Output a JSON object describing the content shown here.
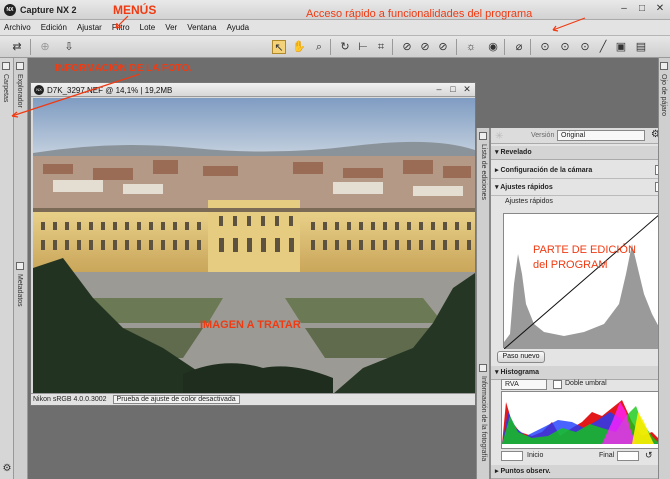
{
  "window": {
    "title": "Capture NX 2",
    "logo_text": "NX"
  },
  "menu": {
    "items": [
      "Archivo",
      "Edición",
      "Ajustar",
      "Filtro",
      "Lote",
      "Ver",
      "Ventana",
      "Ayuda"
    ]
  },
  "left_panels": {
    "carpetas": "Carpetas",
    "explorador": "Explorador",
    "metadatos": "Metadatos"
  },
  "image_window": {
    "title": "D7K_3297.NEF @ 14,1% | 19,2MB",
    "profile": "Nikon sRGB 4.0.0.3002",
    "proof_select": "Prueba de ajuste de color desactivada"
  },
  "right_strips": {
    "edit_list": "Lista de ediciones",
    "photo_info": "Información de la fotografía",
    "eye_label": "Ojo de pájaro"
  },
  "edit_panel": {
    "version_label": "Versión",
    "version_value": "Original",
    "revelado": "Revelado",
    "camera_config": "Configuración de la cámara",
    "quick_adjust_header": "Ajustes rápidos",
    "quick_adjust_item": "Ajustes rápidos",
    "new_step_button": "Paso nuevo"
  },
  "histogram_panel": {
    "header": "Histograma",
    "channel": "RVA",
    "double_threshold": "Doble umbral",
    "start_label": "Inicio",
    "end_label": "Final",
    "points_header": "Puntos observ."
  },
  "annotations": {
    "menus": "MENÚS",
    "quick_access": "Acceso rápido a funcionalidades del programa",
    "photo_info": "INFORMACIÓN DE LA FOTO.",
    "edit_part_1": "PARTE DE EDICIÓN",
    "edit_part_2": "del PROGRAM",
    "image": "IMAGEN A TRATAR"
  },
  "colors": {
    "annotation": "#f03a12",
    "toolbar_active": "#f3d27a"
  }
}
